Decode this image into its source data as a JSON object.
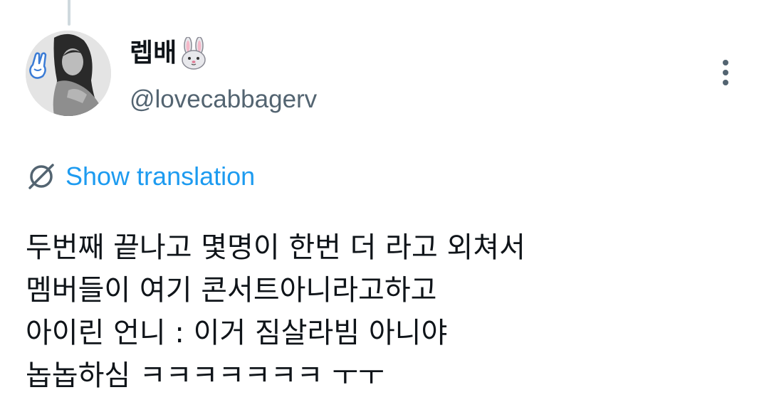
{
  "author": {
    "display_name": "렙배",
    "name_emoji": "rabbit-face-icon",
    "handle": "@lovecabbagerv",
    "avatar": "profile-photo-avatar"
  },
  "actions": {
    "more": "more-options-icon",
    "translation_icon": "globe-icon",
    "translation_label": "Show translation"
  },
  "tweet": {
    "lines": [
      "두번째 끝나고 몇명이 한번 더 라고 외쳐서",
      "멤버들이 여기 콘서트아니라고하고",
      "아이린 언니 : 이거 짐살라빔 아니야",
      "놉놉하심 ㅋㅋㅋㅋㅋㅋㅋ ㅜㅜ"
    ]
  },
  "colors": {
    "text_primary": "#0f1419",
    "text_secondary": "#536471",
    "accent": "#1d9bf0",
    "thread_line": "#cfd9de"
  }
}
